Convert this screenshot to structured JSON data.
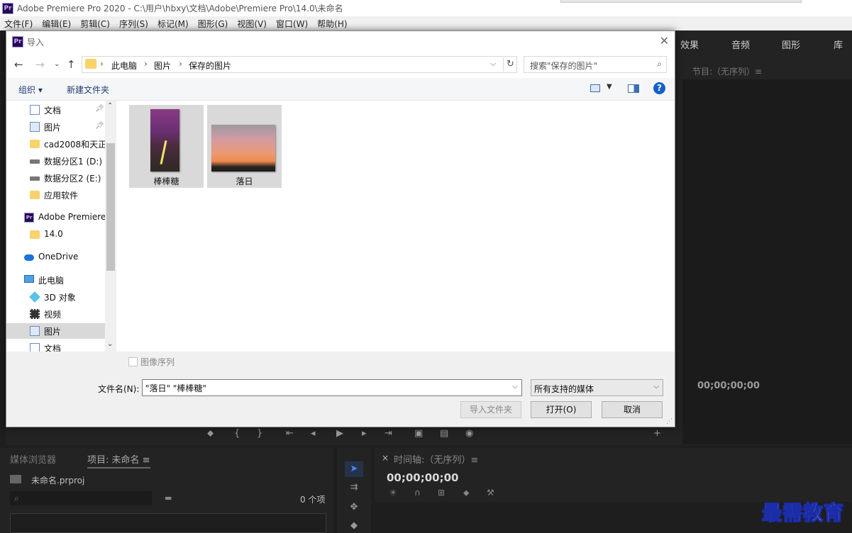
{
  "premiere": {
    "title": "Adobe Premiere Pro 2020 - C:\\用户\\hbxy\\文档\\Adobe\\Premiere Pro\\14.0\\未命名",
    "logo": "Pr",
    "menu": [
      "文件(F)",
      "编辑(E)",
      "剪辑(C)",
      "序列(S)",
      "标记(M)",
      "图形(G)",
      "视图(V)",
      "窗口(W)",
      "帮助(H)"
    ],
    "workspace_tabs": [
      "效果",
      "音频",
      "图形",
      "库"
    ],
    "program_monitor_label": "节目:（无序列）≡",
    "program_timecode": "00;00;00;00",
    "project": {
      "tab_media": "媒体浏览器",
      "tab_project": "项目: 未命名 ≡",
      "file": "未命名.prproj",
      "item_count": "0 个项"
    },
    "timeline": {
      "close": "×",
      "title": "时间轴:（无序列）≡",
      "timecode": "00;00;00;00"
    }
  },
  "watermark": "最需教育",
  "dialog": {
    "title": "导入",
    "address": [
      "此电脑",
      "图片",
      "保存的图片"
    ],
    "search_placeholder": "搜索\"保存的图片\"",
    "toolbar": {
      "organize": "组织 ▾",
      "new_folder": "新建文件夹",
      "help": "?"
    },
    "nav_items": [
      {
        "label": "文档",
        "icon": "document-icon",
        "pinned": true
      },
      {
        "label": "图片",
        "icon": "pictures-icon",
        "pinned": true
      },
      {
        "label": "cad2008和天正",
        "icon": "folder-icon",
        "pinned": false
      },
      {
        "label": "数据分区1 (D:)",
        "icon": "drive-icon",
        "pinned": false
      },
      {
        "label": "数据分区2 (E:)",
        "icon": "drive-icon",
        "pinned": false
      },
      {
        "label": "应用软件",
        "icon": "folder-icon",
        "pinned": false
      },
      {
        "label": "Adobe Premiere",
        "icon": "premiere-icon",
        "pinned": false
      },
      {
        "label": "14.0",
        "icon": "folder-icon",
        "pinned": false
      },
      {
        "label": "OneDrive",
        "icon": "onedrive-icon",
        "pinned": false
      },
      {
        "label": "此电脑",
        "icon": "computer-icon",
        "pinned": false
      },
      {
        "label": "3D 对象",
        "icon": "3d-objects-icon",
        "pinned": false
      },
      {
        "label": "视频",
        "icon": "video-icon",
        "pinned": false
      },
      {
        "label": "图片",
        "icon": "pictures-icon",
        "pinned": false,
        "selected": true
      },
      {
        "label": "文档",
        "icon": "document-icon",
        "pinned": false
      }
    ],
    "files": [
      {
        "name": "棒棒糖"
      },
      {
        "name": "落日"
      }
    ],
    "image_sequence_label": "图像序列",
    "file_name_label": "文件名(N):",
    "file_name_value": "\"落日\" \"棒棒糖\"",
    "file_type": "所有支持的媒体",
    "buttons": {
      "import_folder": "导入文件夹",
      "open": "打开(O)",
      "cancel": "取消"
    }
  }
}
